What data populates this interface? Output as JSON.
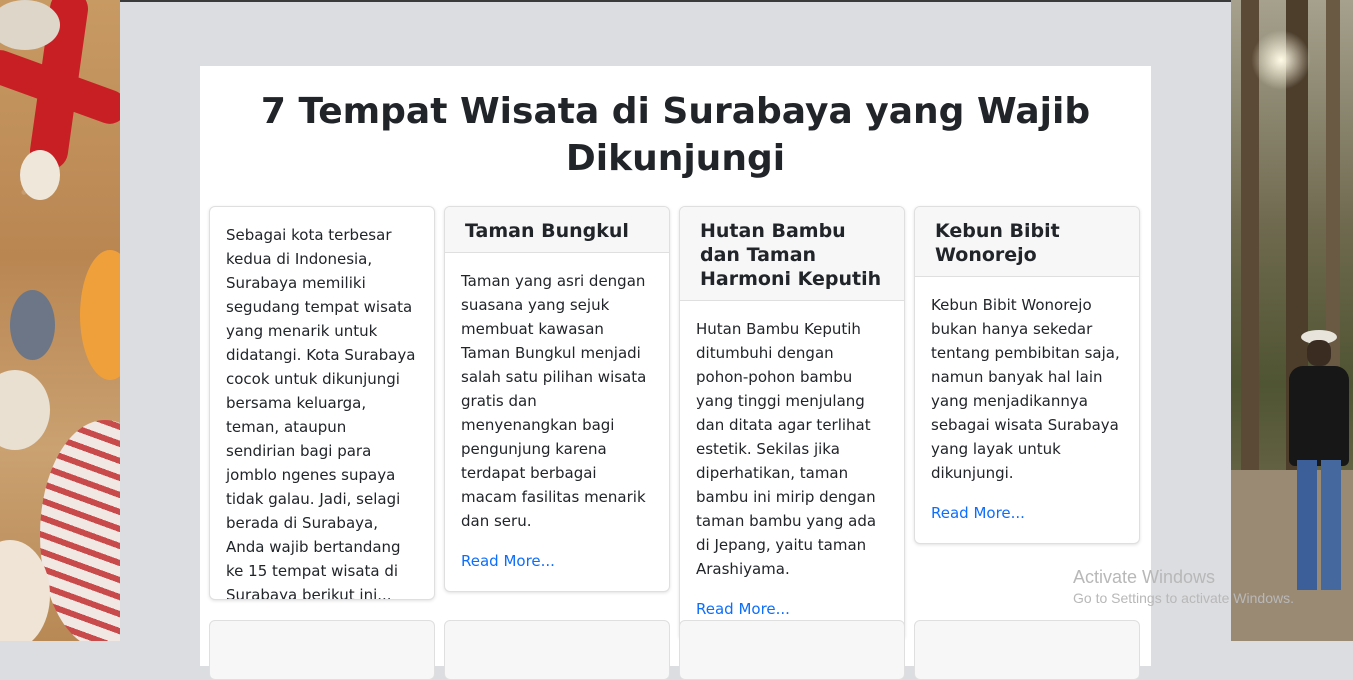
{
  "page": {
    "title": "7 Tempat Wisata di Surabaya yang Wajib Dikunjungi"
  },
  "intro": {
    "text": "Sebagai kota terbesar kedua di Indonesia, Surabaya memiliki segudang tempat wisata yang menarik untuk didatangi. Kota Surabaya cocok untuk dikunjungi bersama keluarga, teman, ataupun sendirian bagi para jomblo ngenes supaya tidak galau. Jadi, selagi berada di Surabaya, Anda wajib bertandang ke 15 tempat wisata di Surabaya berikut ini..."
  },
  "cards": [
    {
      "title": "Taman Bungkul",
      "text": "Taman yang asri dengan suasana yang sejuk membuat kawasan Taman Bungkul menjadi salah satu pilihan wisata gratis dan menyenangkan bagi pengunjung karena terdapat berbagai macam fasilitas menarik dan seru.",
      "link": "Read More..."
    },
    {
      "title": "Hutan Bambu dan Taman Harmoni Keputih",
      "text": "Hutan Bambu Keputih ditumbuhi dengan pohon-pohon bambu yang tinggi menjulang dan ditata agar terlihat estetik. Sekilas jika diperhatikan, taman bambu ini mirip dengan taman bambu yang ada di Jepang, yaitu taman Arashiyama.",
      "link": "Read More..."
    },
    {
      "title": "Kebun Bibit Wonorejo",
      "text": "Kebun Bibit Wonorejo bukan hanya sekedar tentang pembibitan saja, namun banyak hal lain yang menjadikannya sebagai wisata Surabaya yang layak untuk dikunjungi.",
      "link": "Read More..."
    }
  ],
  "watermark": {
    "line1": "Activate Windows",
    "line2": "Go to Settings to activate Windows."
  }
}
